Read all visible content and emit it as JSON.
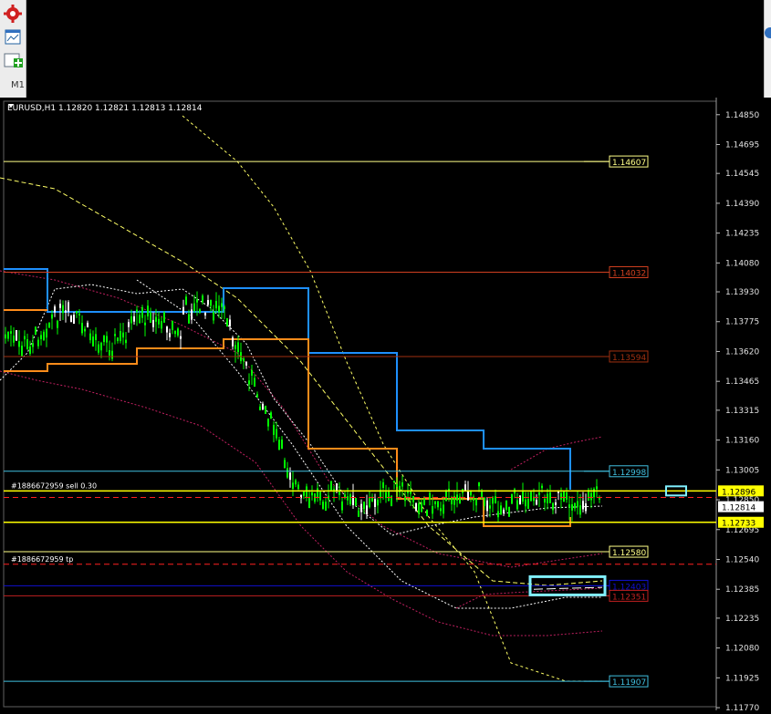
{
  "window": {
    "timeframe_tab": "M1"
  },
  "chart": {
    "header": "EURUSD,H1  1.12820 1.12821 1.12813 1.12814",
    "symbol": "EURUSD",
    "timeframe": "H1",
    "price_min": 1.11775,
    "price_max": 1.1492
  },
  "price_axis": {
    "ticks": [
      "1.14850",
      "1.14695",
      "1.14545",
      "1.14390",
      "1.14235",
      "1.14080",
      "1.13930",
      "1.13775",
      "1.13620",
      "1.13465",
      "1.13315",
      "1.13160",
      "1.13005",
      "1.12850",
      "1.12695",
      "1.12540",
      "1.12385",
      "1.12235",
      "1.12080",
      "1.11925",
      "1.11770"
    ],
    "labels": [
      {
        "text": "1.12896",
        "bg": "#ffff00",
        "fg": "#000000"
      },
      {
        "text": "1.12814",
        "bg": "#ffffff",
        "fg": "#000000"
      },
      {
        "text": "1.12733",
        "bg": "#ffff00",
        "fg": "#000000"
      }
    ]
  },
  "levels": [
    {
      "name": "level-1-14607",
      "label": "1.14607",
      "price": 1.14607,
      "color": "#ffff88",
      "dash": "none"
    },
    {
      "name": "level-1-14032",
      "label": "1.14032",
      "price": 1.14032,
      "color": "#d04020",
      "dash": "none"
    },
    {
      "name": "level-1-13594",
      "label": "1.13594",
      "price": 1.13594,
      "color": "#a03010",
      "dash": "none"
    },
    {
      "name": "level-1-12998",
      "label": "1.12998",
      "price": 1.12998,
      "color": "#40c0e0",
      "dash": "none"
    },
    {
      "name": "level-1-12580",
      "label": "1.12580",
      "price": 1.1258,
      "color": "#ffff88",
      "dash": "none"
    },
    {
      "name": "level-1-12403",
      "label": "1.12403",
      "price": 1.12403,
      "color": "#1010d0",
      "dash": "none"
    },
    {
      "name": "level-1-12351",
      "label": "1.12351",
      "price": 1.12351,
      "color": "#c02020",
      "dash": "none"
    },
    {
      "name": "level-1-11907",
      "label": "1.11907",
      "price": 1.11907,
      "color": "#40c0e0",
      "dash": "none"
    }
  ],
  "orders": [
    {
      "name": "order-sell",
      "label": "#1886672959 sell 0.30",
      "price": 1.12896,
      "color": "#ffff00",
      "dash": "none"
    },
    {
      "name": "order-sl",
      "label": "",
      "price": 1.12862,
      "color": "#ff2020",
      "dash": "6,4"
    },
    {
      "name": "order-tp-line",
      "label": "#1886672959 tp",
      "price": 1.12515,
      "color": "#ff2020",
      "dash": "6,4"
    },
    {
      "name": "order-yellow-low",
      "label": "",
      "price": 1.12733,
      "color": "#ffff00",
      "dash": "none"
    }
  ],
  "colors": {
    "candle": "#00ff00",
    "candle_alt": "#ffffff",
    "blue_channel": "#1e90ff",
    "orange_channel": "#ff8c1a",
    "bands": "#ffffff",
    "ma_slow": "#ffff66",
    "ma_magenta": "#c02060"
  }
}
